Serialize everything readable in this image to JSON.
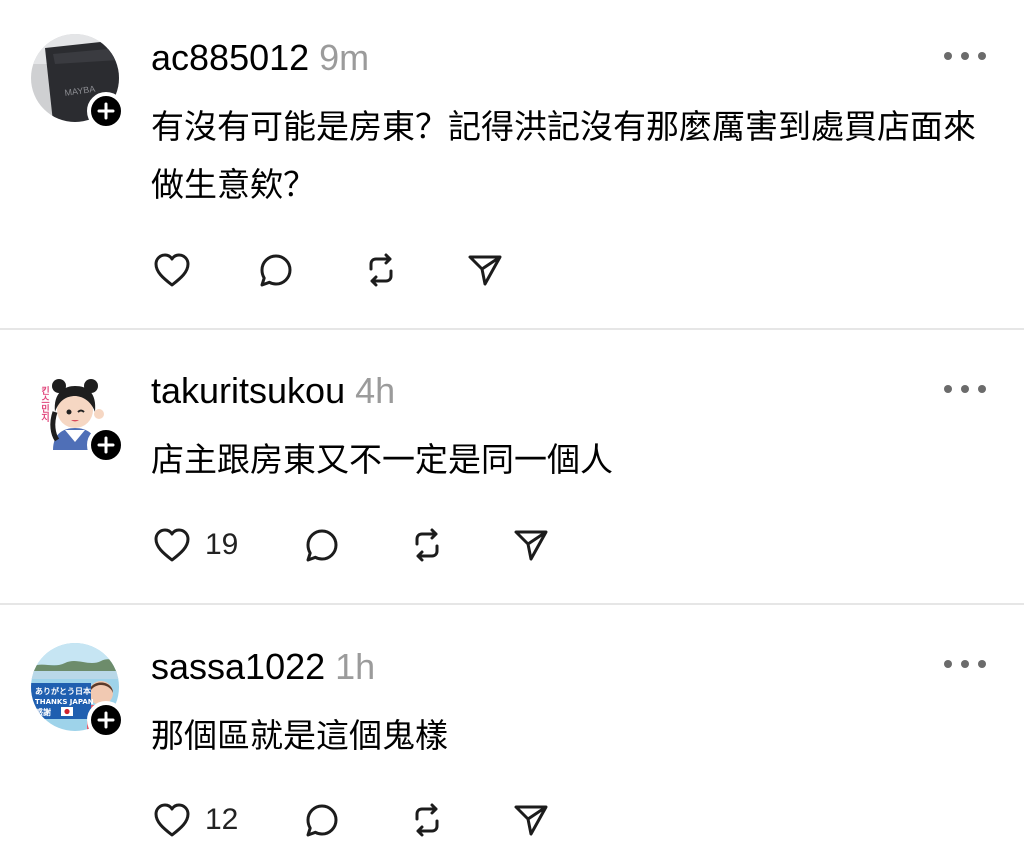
{
  "posts": [
    {
      "username": "ac885012",
      "time": "9m",
      "avatar_icon": "black-device-avatar",
      "avatar_logo_text": "MAYBA",
      "text": "有沒有可能是房東？記得洪記沒有那麼厲害到處買店面來做生意欸？",
      "like_count": "",
      "icons": [
        "heart-icon",
        "comment-icon",
        "repost-icon",
        "share-icon"
      ]
    },
    {
      "username": "takuritsukou",
      "time": "4h",
      "avatar_icon": "cartoon-girl-avatar",
      "avatar_side_text": "킨스민지",
      "text": "店主跟房東又不一定是同一個人",
      "like_count": "19",
      "icons": [
        "heart-icon",
        "comment-icon",
        "repost-icon",
        "share-icon"
      ]
    },
    {
      "username": "sassa1022",
      "time": "1h",
      "avatar_icon": "thanks-japan-avatar",
      "avatar_banner_text": [
        "ありがとう日本",
        "THANKS JAPAN",
        "感謝"
      ],
      "text": "那個區就是這個鬼樣",
      "like_count": "12",
      "icons": [
        "heart-icon",
        "comment-icon",
        "repost-icon",
        "share-icon"
      ]
    }
  ],
  "colors": {
    "text": "#000000",
    "timestamp": "#9b9b9b",
    "icon": "#1c1c1c",
    "divider": "#e6e6e6",
    "badge": "#000000"
  }
}
